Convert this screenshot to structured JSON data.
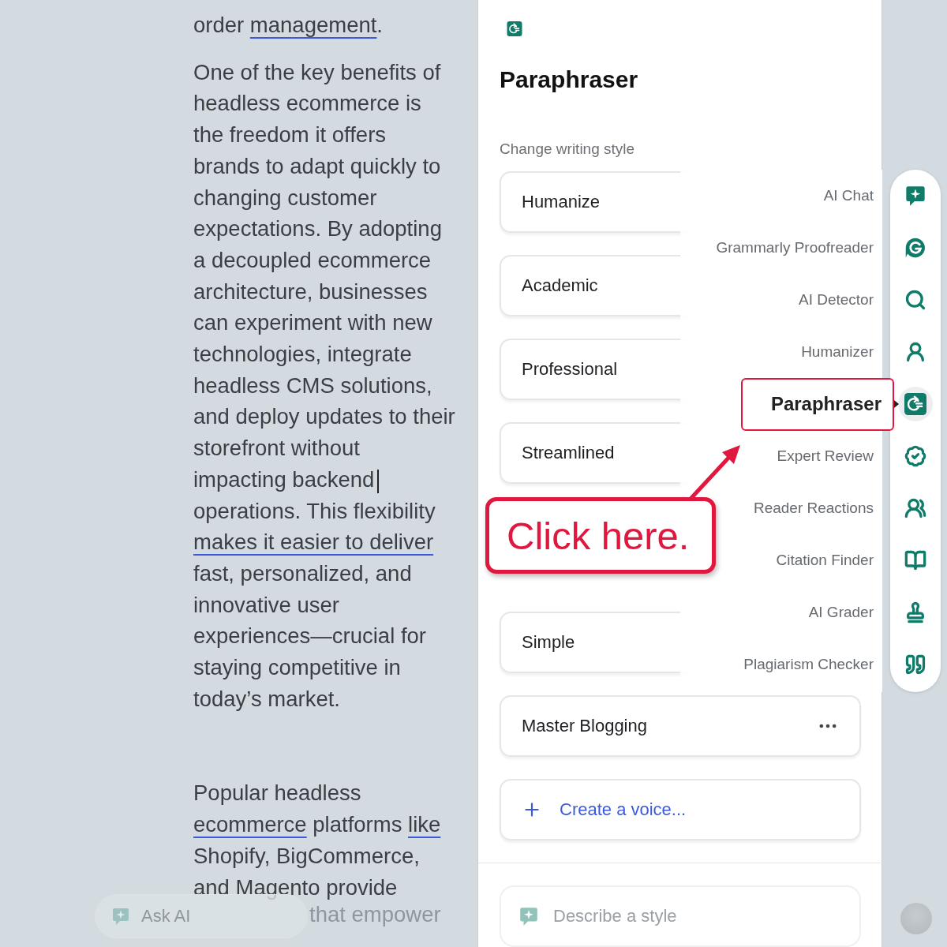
{
  "document": {
    "paragraphs": [
      {
        "segments": [
          {
            "text": "order "
          },
          {
            "text": "management",
            "underline": true
          },
          {
            "text": "."
          }
        ]
      },
      {
        "segments": [
          {
            "text": "One of the key benefits of headless ecommerce is the freedom it offers brands to adapt quickly to changing customer expectations. By adopting a decoupled ecommerce architecture, businesses can experiment with new technologies, integrate headless CMS solutions, and deploy updates to their storefront without impacting backend",
            "caret": true
          },
          {
            "text": " operations. This flexibility "
          },
          {
            "text": "makes it easier to deliver",
            "underline": true
          },
          {
            "text": " fast, personalized, and innovative user experiences—crucial for staying competitive in today’s market."
          }
        ]
      },
      {
        "segments": [
          {
            "text": "Popular headless "
          },
          {
            "text": "ecommerce",
            "underline": true
          },
          {
            "text": " platforms "
          },
          {
            "text": "like",
            "underline": true
          },
          {
            "text": " Shopify, BigCommerce, and Magento provide"
          }
        ]
      }
    ],
    "faded_line": "that empower",
    "ask_ai": {
      "placeholder": "Ask AI"
    }
  },
  "panel": {
    "title": "Paraphraser",
    "section_label": "Change writing style",
    "styles": [
      {
        "label": "Humanize",
        "kind": "style"
      },
      {
        "label": "Academic",
        "kind": "style"
      },
      {
        "label": "Professional",
        "kind": "style"
      },
      {
        "label": "Streamlined",
        "kind": "style"
      },
      {
        "label": "Simple",
        "kind": "style"
      },
      {
        "label": "Master Blogging",
        "kind": "custom"
      },
      {
        "label": "Create a voice...",
        "kind": "create"
      }
    ],
    "describe_field": {
      "placeholder": "Describe a style"
    }
  },
  "tool_menu": [
    {
      "label": "AI Chat",
      "selected": false
    },
    {
      "label": "Grammarly Proofreader",
      "selected": false
    },
    {
      "label": "AI Detector",
      "selected": false
    },
    {
      "label": "Humanizer",
      "selected": false
    },
    {
      "label": "Paraphraser",
      "selected": true
    },
    {
      "label": "Expert Review",
      "selected": false
    },
    {
      "label": "Reader Reactions",
      "selected": false
    },
    {
      "label": "Citation Finder",
      "selected": false
    },
    {
      "label": "AI Grader",
      "selected": false
    },
    {
      "label": "Plagiarism Checker",
      "selected": false
    }
  ],
  "callout": {
    "text": "Click here."
  }
}
